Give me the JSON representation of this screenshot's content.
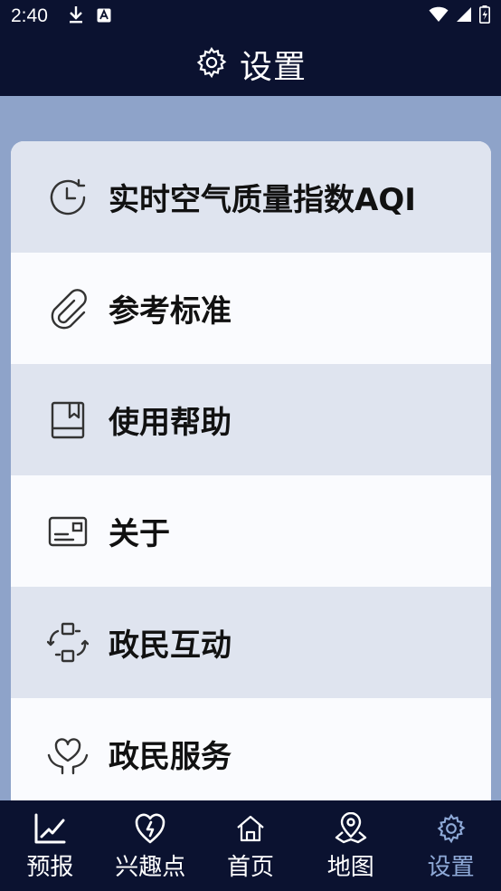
{
  "status_bar": {
    "time": "2:40"
  },
  "header": {
    "title": "设置",
    "icon": "gear-icon"
  },
  "menu": [
    {
      "label": "实时空气质量指数AQI",
      "icon": "clock-icon"
    },
    {
      "label": "参考标准",
      "icon": "paperclip-icon"
    },
    {
      "label": "使用帮助",
      "icon": "bookmark-book-icon"
    },
    {
      "label": "关于",
      "icon": "id-card-icon"
    },
    {
      "label": "政民互动",
      "icon": "interaction-icon"
    },
    {
      "label": "政民服务",
      "icon": "heart-hands-icon"
    }
  ],
  "tabs": [
    {
      "label": "预报",
      "icon": "chart-icon",
      "active": false
    },
    {
      "label": "兴趣点",
      "icon": "heart-location-icon",
      "active": false
    },
    {
      "label": "首页",
      "icon": "home-icon",
      "active": false
    },
    {
      "label": "地图",
      "icon": "map-pin-icon",
      "active": false
    },
    {
      "label": "设置",
      "icon": "gear-icon",
      "active": true
    }
  ],
  "colors": {
    "dark_bar": "#0b1230",
    "background": "#8ea3c9",
    "active_tab": "#8faad8",
    "row_shade": "#dfe4ef"
  }
}
